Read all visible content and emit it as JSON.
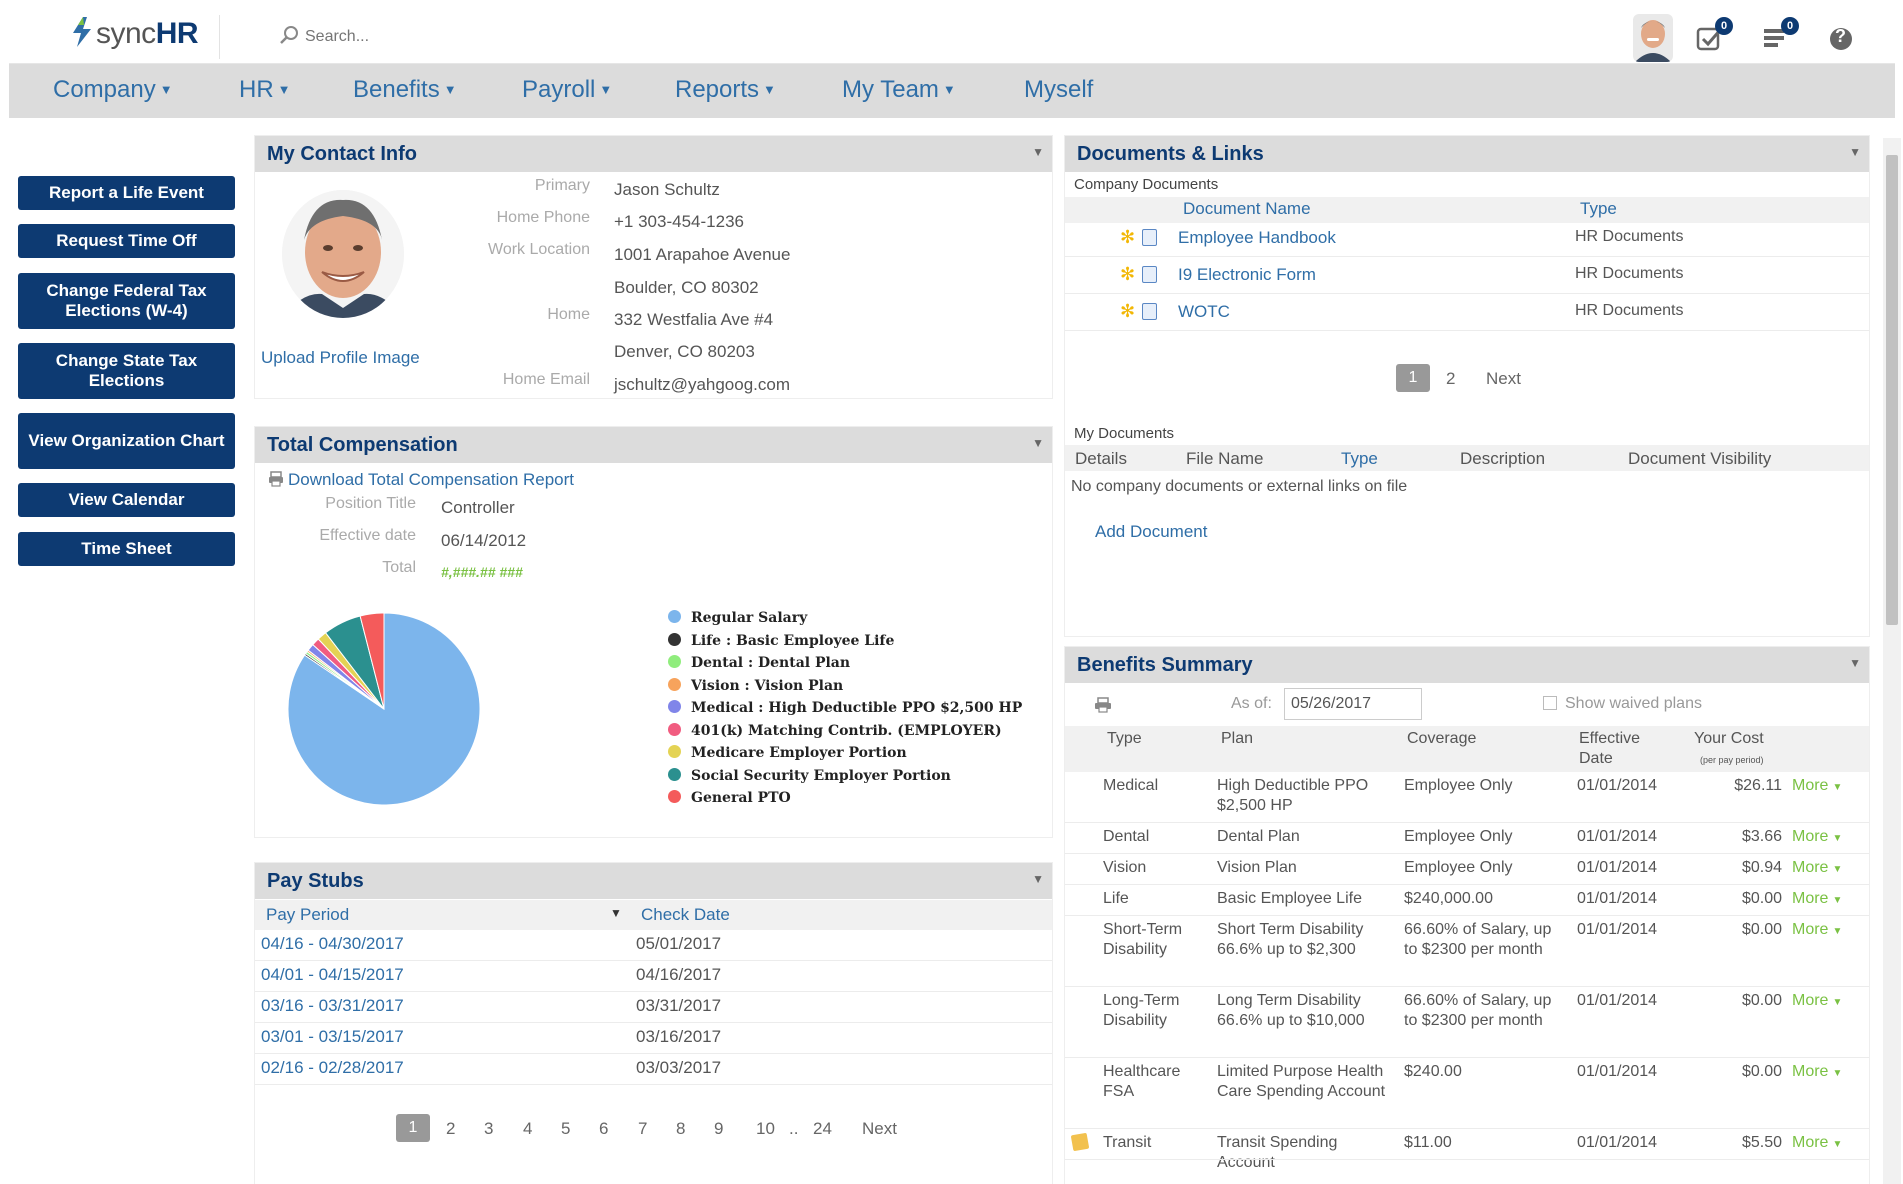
{
  "app": {
    "logo_text_light": "sync",
    "logo_text_bold": "HR",
    "search_placeholder": "Search...",
    "tasks_badge": "0",
    "messages_badge": "0",
    "help_glyph": "?"
  },
  "nav": {
    "items": [
      "Company",
      "HR",
      "Benefits",
      "Payroll",
      "Reports",
      "My Team",
      "Myself"
    ]
  },
  "actions": [
    "Report a Life Event",
    "Request Time Off",
    "Change Federal Tax Elections (W-4)",
    "Change State Tax Elections",
    "View Organization Chart",
    "View Calendar",
    "Time Sheet"
  ],
  "contact": {
    "title": "My Contact Info",
    "upload_label": "Upload Profile Image",
    "primary_label": "Primary",
    "primary": "Jason Schultz",
    "home_phone_label": "Home Phone",
    "home_phone": "+1 303-454-1236",
    "work_location_label": "Work Location",
    "work_line1": "1001 Arapahoe Avenue",
    "work_line2": "Boulder, CO 80302",
    "home_label": "Home",
    "home_line1": "332 Westfalia Ave #4",
    "home_line2": "Denver, CO 80203",
    "home_email_label": "Home Email",
    "home_email": "jschultz@yahgoog.com"
  },
  "compensation": {
    "title": "Total Compensation",
    "download_label": "Download Total Compensation Report",
    "position_label": "Position Title",
    "position": "Controller",
    "effective_label": "Effective date",
    "effective": "06/14/2012",
    "total_label": "Total",
    "total": "#,###.## ###"
  },
  "chart_data": {
    "type": "pie",
    "labels": [
      "Regular Salary",
      "Life : Basic Employee Life",
      "Dental : Dental Plan",
      "Vision : Vision Plan",
      "Medical : High Deductible PPO $2,500 HP",
      "401(k) Matching Contrib. (EMPLOYER)",
      "Medicare Employer Portion",
      "Social Security Employer Portion",
      "General PTO"
    ],
    "values": [
      84.5,
      0.3,
      0.4,
      0.3,
      1.2,
      1.3,
      1.6,
      6.4,
      4.0
    ],
    "colors": [
      "#7cb5ec",
      "#333333",
      "#90ed7d",
      "#f7a35c",
      "#8085e9",
      "#f15c80",
      "#e4d354",
      "#2b908f",
      "#f45b5b"
    ],
    "legend_position": "right"
  },
  "paystubs": {
    "title": "Pay Stubs",
    "col_period": "Pay Period",
    "col_check": "Check Date",
    "sort_glyph": "▼",
    "rows": [
      {
        "period": "04/16 - 04/30/2017",
        "check": "05/01/2017"
      },
      {
        "period": "04/01 - 04/15/2017",
        "check": "04/16/2017"
      },
      {
        "period": "03/16 - 03/31/2017",
        "check": "03/31/2017"
      },
      {
        "period": "03/01 - 03/15/2017",
        "check": "03/16/2017"
      },
      {
        "period": "02/16 - 02/28/2017",
        "check": "03/03/2017"
      }
    ],
    "pages": [
      "1",
      "2",
      "3",
      "4",
      "5",
      "6",
      "7",
      "8",
      "9",
      "10",
      "..",
      "24"
    ],
    "next": "Next"
  },
  "documents": {
    "title": "Documents & Links",
    "company_label": "Company Documents",
    "col_name": "Document Name",
    "col_type": "Type",
    "rows": [
      {
        "name": "Employee Handbook",
        "type": "HR Documents"
      },
      {
        "name": "I9 Electronic Form",
        "type": "HR Documents"
      },
      {
        "name": "WOTC",
        "type": "HR Documents"
      }
    ],
    "pages": [
      "1",
      "2"
    ],
    "next": "Next",
    "my_label": "My Documents",
    "my_cols": [
      "Details",
      "File Name",
      "Type",
      "Description",
      "Document Visibility"
    ],
    "empty": "No company documents or external links on file",
    "add_label": "Add Document"
  },
  "benefits": {
    "title": "Benefits Summary",
    "as_of_label": "As of:",
    "as_of": "05/26/2017",
    "waived_label": "Show waived plans",
    "col_type": "Type",
    "col_plan": "Plan",
    "col_coverage": "Coverage",
    "col_effective": "Effective Date",
    "col_cost": "Your Cost",
    "col_cost_sub": "(per pay period)",
    "more_label": "More",
    "rows": [
      {
        "type": "Medical",
        "plan": "High Deductible PPO $2,500 HP",
        "coverage": "Employee Only",
        "date": "01/01/2014",
        "cost": "$26.11"
      },
      {
        "type": "Dental",
        "plan": "Dental Plan",
        "coverage": "Employee Only",
        "date": "01/01/2014",
        "cost": "$3.66"
      },
      {
        "type": "Vision",
        "plan": "Vision Plan",
        "coverage": "Employee Only",
        "date": "01/01/2014",
        "cost": "$0.94"
      },
      {
        "type": "Life",
        "plan": "Basic Employee Life",
        "coverage": "$240,000.00",
        "date": "01/01/2014",
        "cost": "$0.00"
      },
      {
        "type": "Short-Term Disability",
        "plan": "Short Term Disability 66.6% up to $2,300",
        "coverage": "66.60% of Salary, up to $2300 per month",
        "date": "01/01/2014",
        "cost": "$0.00"
      },
      {
        "type": "Long-Term Disability",
        "plan": "Long Term Disability 66.6% up to $10,000",
        "coverage": "66.60% of Salary, up to $2300 per month",
        "date": "01/01/2014",
        "cost": "$0.00"
      },
      {
        "type": "Healthcare FSA",
        "plan": "Limited Purpose Health Care Spending Account",
        "coverage": "$240.00",
        "date": "01/01/2014",
        "cost": "$0.00"
      },
      {
        "type": "Transit",
        "plan": "Transit Spending Account",
        "coverage": "$11.00",
        "date": "01/01/2014",
        "cost": "$5.50"
      }
    ]
  }
}
